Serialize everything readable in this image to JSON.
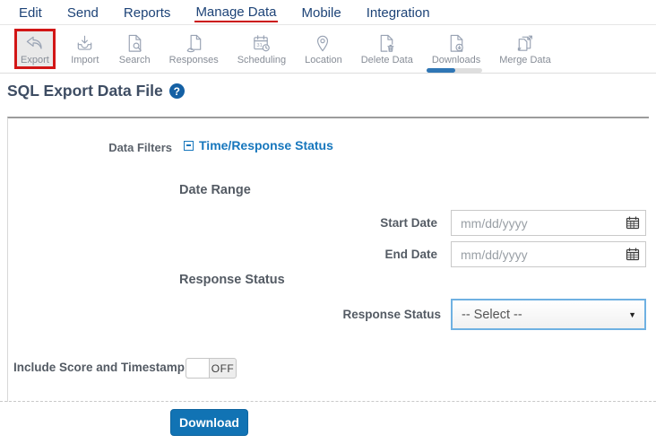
{
  "nav": {
    "items": [
      {
        "label": "Edit",
        "active": false
      },
      {
        "label": "Send",
        "active": false
      },
      {
        "label": "Reports",
        "active": false
      },
      {
        "label": "Manage Data",
        "active": true
      },
      {
        "label": "Mobile",
        "active": false
      },
      {
        "label": "Integration",
        "active": false
      }
    ]
  },
  "toolbar": {
    "items": [
      {
        "label": "Export",
        "icon": "export-arrow-icon",
        "active": true
      },
      {
        "label": "Import",
        "icon": "import-tray-icon",
        "active": false
      },
      {
        "label": "Search",
        "icon": "document-search-icon",
        "active": false
      },
      {
        "label": "Responses",
        "icon": "document-hand-icon",
        "active": false
      },
      {
        "label": "Scheduling",
        "icon": "calendar-clock-icon",
        "active": false
      },
      {
        "label": "Location",
        "icon": "map-pin-icon",
        "active": false
      },
      {
        "label": "Delete Data",
        "icon": "document-trash-icon",
        "active": false
      },
      {
        "label": "Downloads",
        "icon": "document-download-icon",
        "active": false
      },
      {
        "label": "Merge Data",
        "icon": "merge-documents-icon",
        "active": false
      }
    ]
  },
  "page": {
    "title": "SQL Export Data File",
    "help_icon": "?"
  },
  "form": {
    "data_filters_label": "Data Filters",
    "filter_group_label": "Time/Response Status",
    "date_range_heading": "Date Range",
    "start_date": {
      "label": "Start Date",
      "placeholder": "mm/dd/yyyy",
      "value": ""
    },
    "end_date": {
      "label": "End Date",
      "placeholder": "mm/dd/yyyy",
      "value": ""
    },
    "response_status_heading": "Response Status",
    "response_status_label": "Response Status",
    "response_status_value": "-- Select --",
    "include_score_label": "Include Score and Timestamp",
    "toggle_state": "OFF",
    "download_label": "Download"
  },
  "colors": {
    "nav_blue": "#1d4377",
    "link_blue": "#1777bd",
    "highlight_red": "#d21616",
    "underline_red": "#cc1111",
    "button_blue": "#1173b4",
    "icon_gray": "#98a2b3"
  }
}
